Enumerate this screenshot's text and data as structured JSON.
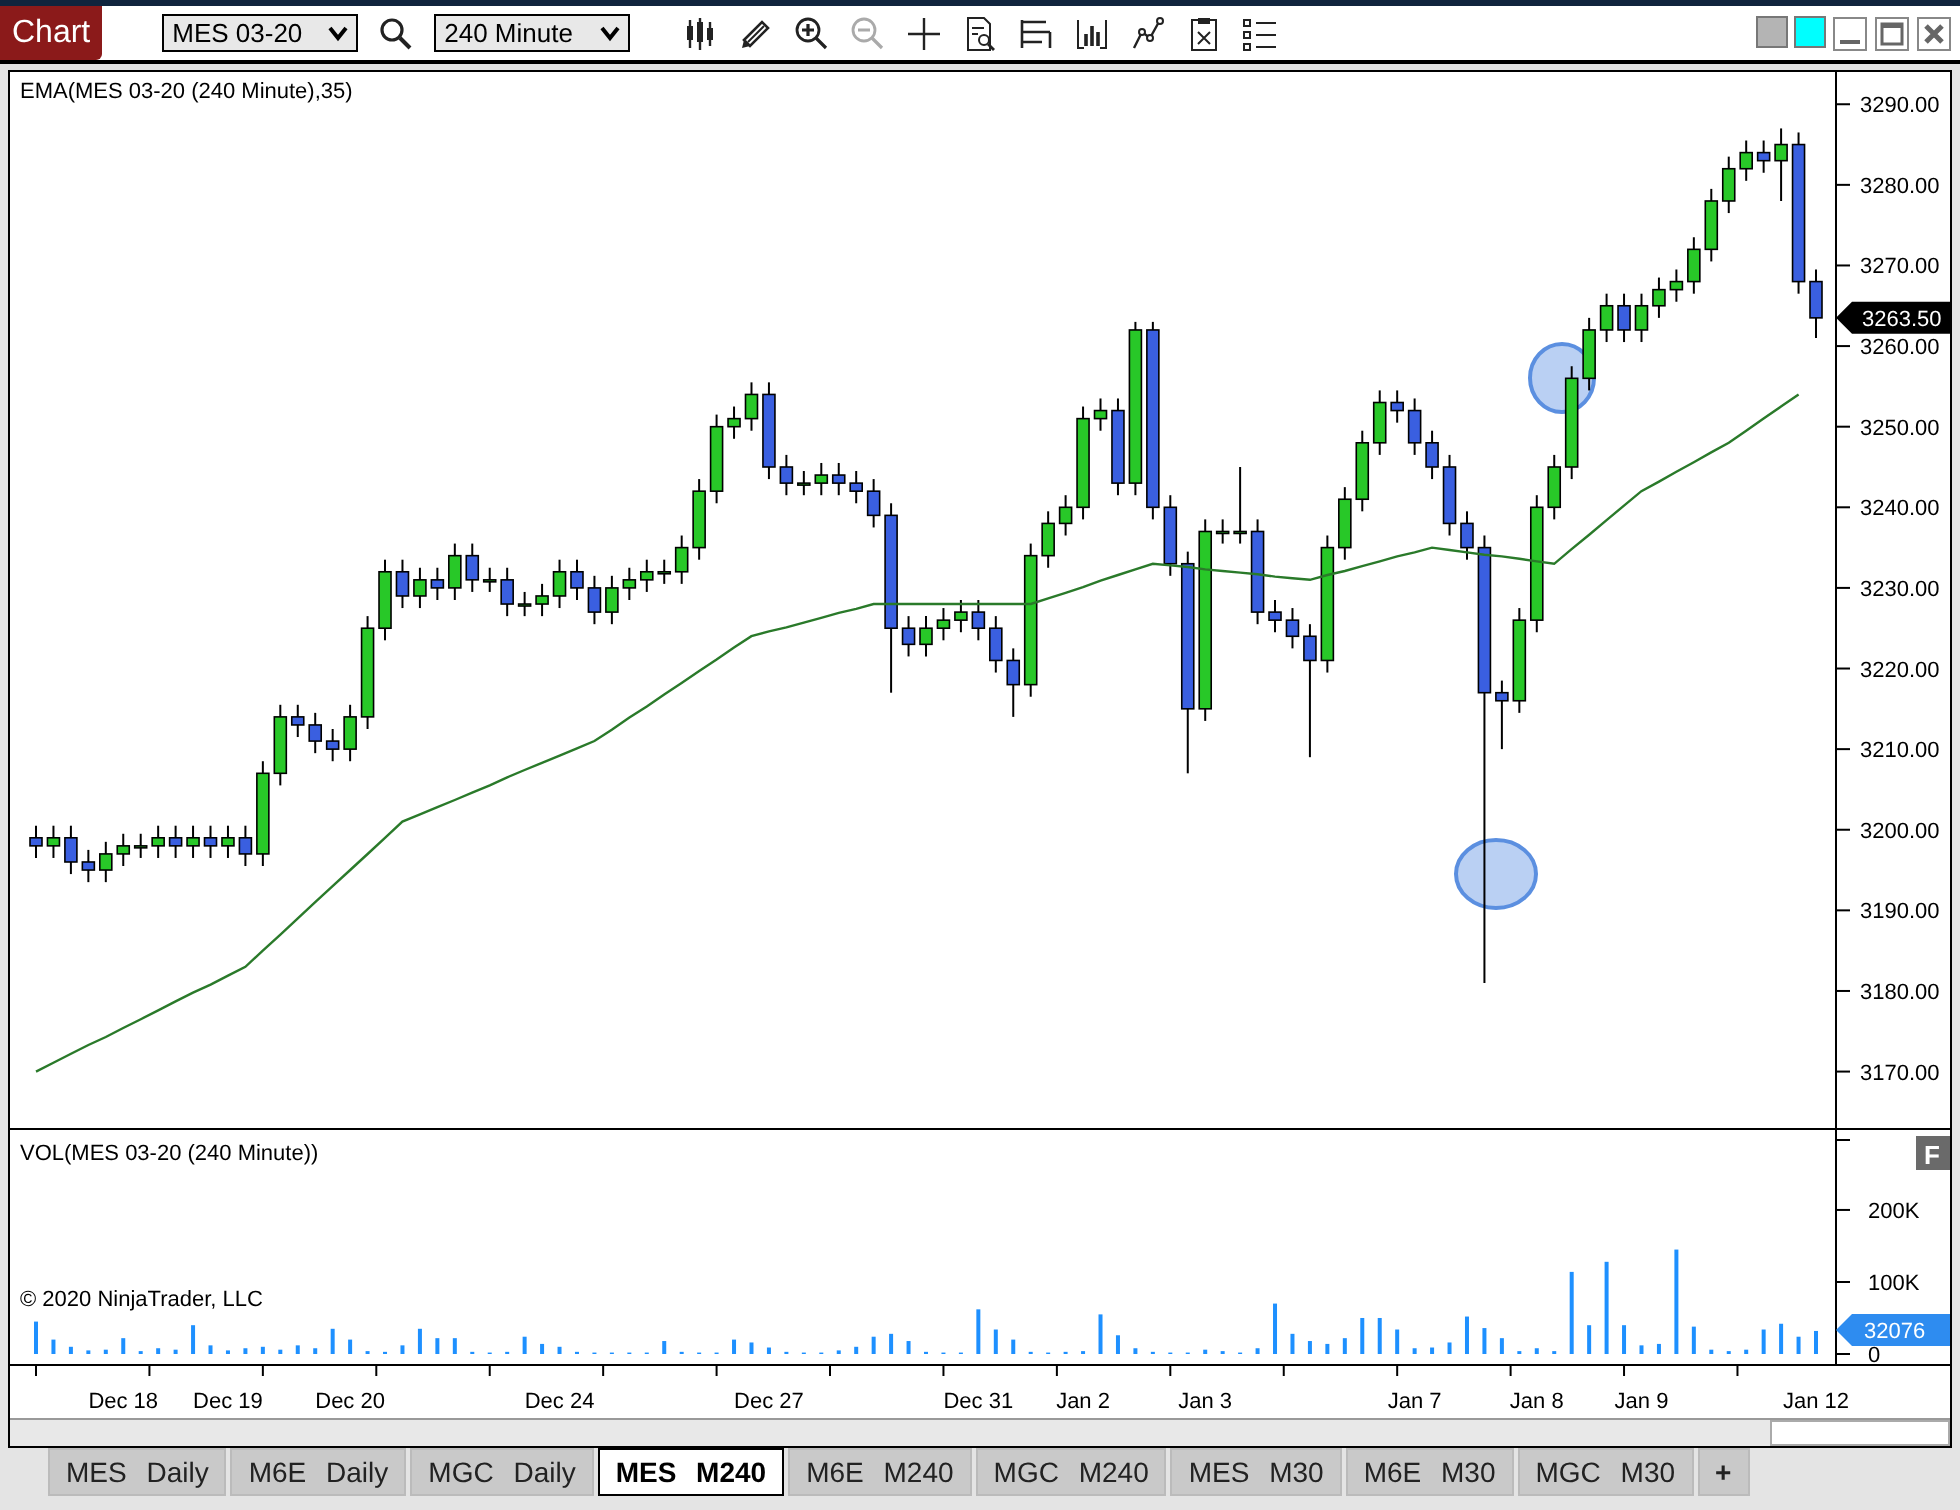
{
  "window": {
    "title": "Chart"
  },
  "toolbar": {
    "instrument": "MES 03-20",
    "interval": "240 Minute"
  },
  "price_panel": {
    "last_price": "3263.50",
    "chart_data": {
      "type": "candlestick",
      "ylim": [
        3163,
        3294
      ],
      "yticks": [
        {
          "value": 3170,
          "label": "3170.00"
        },
        {
          "value": 3180,
          "label": "3180.00"
        },
        {
          "value": 3190,
          "label": "3190.00"
        },
        {
          "value": 3200,
          "label": "3200.00"
        },
        {
          "value": 3210,
          "label": "3210.00"
        },
        {
          "value": 3220,
          "label": "3220.00"
        },
        {
          "value": 3230,
          "label": "3230.00"
        },
        {
          "value": 3240,
          "label": "3240.00"
        },
        {
          "value": 3250,
          "label": "3250.00"
        },
        {
          "value": 3260,
          "label": "3260.00"
        },
        {
          "value": 3270,
          "label": "3270.00"
        },
        {
          "value": 3280,
          "label": "3280.00"
        },
        {
          "value": 3290,
          "label": "3290.00"
        }
      ],
      "categories": [
        null,
        null,
        null,
        null,
        null,
        null,
        null,
        null,
        null,
        null,
        null,
        null,
        null,
        null,
        null,
        null,
        null,
        null,
        null,
        null,
        null,
        null,
        null,
        null,
        null,
        null,
        null,
        null,
        null,
        null,
        null,
        null,
        null,
        null,
        null,
        null,
        null,
        null,
        null,
        null,
        null,
        null,
        null,
        null,
        null,
        null,
        null,
        null,
        null,
        null,
        null,
        null,
        null,
        null,
        null,
        null,
        null,
        null,
        null,
        null,
        null,
        null,
        null,
        null,
        null,
        null,
        null,
        null,
        null,
        null,
        null,
        null,
        null,
        null,
        null,
        null,
        null,
        null,
        null,
        null,
        null,
        null,
        null,
        null,
        null,
        null,
        null,
        null,
        null,
        null,
        null,
        null,
        null,
        null,
        null,
        null,
        null,
        null,
        null,
        null,
        null,
        null,
        null
      ],
      "ohlc": [
        [
          3199,
          3200.5,
          3196.5,
          3198
        ],
        [
          3198,
          3200.5,
          3196.5,
          3199
        ],
        [
          3199,
          3200.5,
          3194.5,
          3196
        ],
        [
          3196,
          3197.5,
          3193.5,
          3195
        ],
        [
          3195,
          3198.5,
          3193.5,
          3197
        ],
        [
          3197,
          3199.5,
          3195.5,
          3198
        ],
        [
          3198,
          3199.5,
          3196.5,
          3198
        ],
        [
          3198,
          3200.5,
          3196.5,
          3199
        ],
        [
          3199,
          3200.5,
          3196.5,
          3198
        ],
        [
          3198,
          3200.5,
          3196.5,
          3199
        ],
        [
          3199,
          3200.5,
          3196.5,
          3198
        ],
        [
          3198,
          3200.5,
          3196.5,
          3199
        ],
        [
          3199,
          3200.5,
          3195.5,
          3197
        ],
        [
          3197,
          3208.5,
          3195.5,
          3207
        ],
        [
          3207,
          3215.5,
          3205.5,
          3214
        ],
        [
          3214,
          3215.5,
          3211.5,
          3213
        ],
        [
          3213,
          3214.5,
          3209.5,
          3211
        ],
        [
          3211,
          3212.5,
          3208.5,
          3210
        ],
        [
          3210,
          3215.5,
          3208.5,
          3214
        ],
        [
          3214,
          3226.5,
          3212.5,
          3225
        ],
        [
          3225,
          3233.5,
          3223.5,
          3232
        ],
        [
          3232,
          3233.5,
          3227.5,
          3229
        ],
        [
          3229,
          3232.5,
          3227.5,
          3231
        ],
        [
          3231,
          3232.5,
          3228.5,
          3230
        ],
        [
          3230,
          3235.5,
          3228.5,
          3234
        ],
        [
          3234,
          3235.5,
          3229.5,
          3231
        ],
        [
          3231,
          3232.5,
          3229.5,
          3231
        ],
        [
          3231,
          3232.5,
          3226.5,
          3228
        ],
        [
          3228,
          3229.5,
          3226.5,
          3228
        ],
        [
          3228,
          3230.5,
          3226.5,
          3229
        ],
        [
          3229,
          3233.5,
          3227.5,
          3232
        ],
        [
          3232,
          3233.5,
          3228.5,
          3230
        ],
        [
          3230,
          3231.5,
          3225.5,
          3227
        ],
        [
          3227,
          3231.5,
          3225.5,
          3230
        ],
        [
          3230,
          3232.5,
          3228.5,
          3231
        ],
        [
          3231,
          3233.5,
          3229.5,
          3232
        ],
        [
          3232,
          3233.5,
          3230.5,
          3232
        ],
        [
          3232,
          3236.5,
          3230.5,
          3235
        ],
        [
          3235,
          3243.5,
          3233.5,
          3242
        ],
        [
          3242,
          3251.5,
          3240.5,
          3250
        ],
        [
          3250,
          3252.5,
          3248.5,
          3251
        ],
        [
          3251,
          3255.5,
          3249.5,
          3254
        ],
        [
          3254,
          3255.5,
          3243.5,
          3245
        ],
        [
          3245,
          3246.5,
          3241.5,
          3243
        ],
        [
          3243,
          3244.5,
          3241.5,
          3243
        ],
        [
          3243,
          3245.5,
          3241.5,
          3244
        ],
        [
          3244,
          3245.5,
          3241.5,
          3243
        ],
        [
          3243,
          3244.5,
          3240.5,
          3242
        ],
        [
          3242,
          3243.5,
          3237.5,
          3239
        ],
        [
          3239,
          3240.5,
          3217,
          3225
        ],
        [
          3225,
          3226.5,
          3221.5,
          3223
        ],
        [
          3223,
          3226.5,
          3221.5,
          3225
        ],
        [
          3225,
          3227.5,
          3223.5,
          3226
        ],
        [
          3226,
          3228.5,
          3224.5,
          3227
        ],
        [
          3227,
          3228.5,
          3223.5,
          3225
        ],
        [
          3225,
          3226.5,
          3219.5,
          3221
        ],
        [
          3221,
          3222.5,
          3214,
          3218
        ],
        [
          3218,
          3235.5,
          3216.5,
          3234
        ],
        [
          3234,
          3239.5,
          3232.5,
          3238
        ],
        [
          3238,
          3241.5,
          3236.5,
          3240
        ],
        [
          3240,
          3252.5,
          3238.5,
          3251
        ],
        [
          3251,
          3253.5,
          3249.5,
          3252
        ],
        [
          3252,
          3253.5,
          3241.5,
          3243
        ],
        [
          3243,
          3263,
          3241.5,
          3262
        ],
        [
          3262,
          3263,
          3238.5,
          3240
        ],
        [
          3240,
          3241.5,
          3231.5,
          3233
        ],
        [
          3233,
          3234.5,
          3207,
          3215
        ],
        [
          3215,
          3238.5,
          3213.5,
          3237
        ],
        [
          3237,
          3238.5,
          3235.5,
          3237
        ],
        [
          3237,
          3245,
          3235.5,
          3237
        ],
        [
          3237,
          3238.5,
          3225.5,
          3227
        ],
        [
          3227,
          3228.5,
          3224.5,
          3226
        ],
        [
          3226,
          3227.5,
          3222.5,
          3224
        ],
        [
          3224,
          3225.5,
          3209,
          3221
        ],
        [
          3221,
          3236.5,
          3219.5,
          3235
        ],
        [
          3235,
          3242.5,
          3233.5,
          3241
        ],
        [
          3241,
          3249.5,
          3239.5,
          3248
        ],
        [
          3248,
          3254.5,
          3246.5,
          3253
        ],
        [
          3253,
          3254.5,
          3250.5,
          3252
        ],
        [
          3252,
          3253.5,
          3246.5,
          3248
        ],
        [
          3248,
          3249.5,
          3243.5,
          3245
        ],
        [
          3245,
          3246.5,
          3236.5,
          3238
        ],
        [
          3238,
          3239.5,
          3233.5,
          3235
        ],
        [
          3235,
          3236.5,
          3181,
          3217
        ],
        [
          3217,
          3218.5,
          3210,
          3216
        ],
        [
          3216,
          3227.5,
          3214.5,
          3226
        ],
        [
          3226,
          3241.5,
          3224.5,
          3240
        ],
        [
          3240,
          3246.5,
          3238.5,
          3245
        ],
        [
          3245,
          3257.5,
          3243.5,
          3256
        ],
        [
          3256,
          3263.5,
          3254.5,
          3262
        ],
        [
          3262,
          3266.5,
          3260.5,
          3265
        ],
        [
          3265,
          3266.5,
          3260.5,
          3262
        ],
        [
          3262,
          3266.5,
          3260.5,
          3265
        ],
        [
          3265,
          3268.5,
          3263.5,
          3267
        ],
        [
          3267,
          3269.5,
          3265.5,
          3268
        ],
        [
          3268,
          3273.5,
          3266.5,
          3272
        ],
        [
          3272,
          3279.5,
          3270.5,
          3278
        ],
        [
          3278,
          3283.5,
          3276.5,
          3282
        ],
        [
          3282,
          3285.5,
          3280.5,
          3284
        ],
        [
          3284,
          3285.5,
          3281.5,
          3283
        ],
        [
          3283,
          3287,
          3278,
          3285
        ],
        [
          3285,
          3286.5,
          3266.5,
          3268
        ],
        [
          3268,
          3269.5,
          3261,
          3263.5
        ]
      ],
      "series": [
        {
          "name": "EMA(MES 03-20 (240 Minute),35)",
          "type": "line",
          "color": "#2a7a2a",
          "values": [
            3170,
            3171.1,
            3172.2,
            3173.3,
            3174.3,
            3175.4,
            3176.5,
            3177.6,
            3178.7,
            3179.8,
            3180.8,
            3181.9,
            3183,
            3185,
            3187,
            3189,
            3191,
            3193,
            3195,
            3197,
            3199,
            3201,
            3201.9,
            3202.8,
            3203.7,
            3204.6,
            3205.5,
            3206.5,
            3207.4,
            3208.3,
            3209.2,
            3210.1,
            3211,
            3212.4,
            3213.9,
            3215.3,
            3216.8,
            3218.2,
            3219.7,
            3221.1,
            3222.6,
            3224,
            3224.6,
            3225.1,
            3225.7,
            3226.3,
            3226.9,
            3227.4,
            3228,
            3228,
            3228,
            3228,
            3228,
            3228,
            3228,
            3228,
            3228,
            3228,
            3228.7,
            3229.4,
            3230.1,
            3230.9,
            3231.6,
            3232.3,
            3233,
            3232.8,
            3232.6,
            3232.3,
            3232.1,
            3231.9,
            3231.7,
            3231.4,
            3231.2,
            3231,
            3231.6,
            3232.1,
            3232.7,
            3233.3,
            3233.9,
            3234.4,
            3235,
            3234.7,
            3234.4,
            3234.1,
            3233.9,
            3233.6,
            3233.3,
            3233,
            3234.8,
            3236.6,
            3238.4,
            3240.2,
            3242,
            3243.2,
            3244.4,
            3245.6,
            3246.8,
            3248,
            3249.5,
            3251,
            3252.5,
            3254,
            null
          ]
        }
      ]
    }
  },
  "volume_panel": {
    "copyright": "© 2020 NinjaTrader, LLC",
    "last_volume": "32076",
    "f_button": "F",
    "chart_data": {
      "type": "bar",
      "ylim": [
        0,
        311
      ],
      "yticks": [
        {
          "value": 0,
          "label": "0"
        },
        {
          "value": 100,
          "label": "100K"
        },
        {
          "value": 200,
          "label": "200K"
        }
      ],
      "categories": [
        null,
        null,
        null,
        null,
        null,
        "Dec 18",
        null,
        null,
        null,
        null,
        null,
        "Dec 19",
        null,
        null,
        null,
        null,
        null,
        null,
        "Dec 20",
        null,
        null,
        null,
        null,
        null,
        null,
        null,
        null,
        null,
        null,
        null,
        "Dec 24",
        null,
        null,
        null,
        null,
        null,
        null,
        null,
        null,
        null,
        null,
        null,
        "Dec 27",
        null,
        null,
        null,
        null,
        null,
        null,
        null,
        null,
        null,
        null,
        null,
        "Dec 31",
        null,
        null,
        null,
        null,
        null,
        "Jan 2",
        null,
        null,
        null,
        null,
        null,
        null,
        "Jan 3",
        null,
        null,
        null,
        null,
        null,
        null,
        null,
        null,
        null,
        null,
        null,
        "Jan 7",
        null,
        null,
        null,
        null,
        null,
        null,
        "Jan 8",
        null,
        null,
        null,
        null,
        null,
        "Jan 9",
        null,
        null,
        null,
        null,
        null,
        null,
        null,
        null,
        null,
        "Jan 12"
      ],
      "series": [
        {
          "name": "VOL(MES 03-20 (240 Minute))",
          "color": "#1e90ff",
          "values": [
            45,
            20,
            10,
            5,
            6,
            22,
            4,
            8,
            6,
            40,
            12,
            5,
            8,
            10,
            6,
            12,
            8,
            35,
            20,
            4,
            3,
            12,
            35,
            22,
            22,
            3,
            2,
            3,
            24,
            14,
            10,
            3,
            2,
            2,
            2,
            2,
            18,
            3,
            2,
            2,
            20,
            16,
            9,
            3,
            2,
            2,
            5,
            10,
            24,
            28,
            18,
            3,
            2,
            2,
            62,
            34,
            20,
            3,
            2,
            3,
            4,
            55,
            26,
            8,
            3,
            2,
            2,
            6,
            4,
            2,
            8,
            70,
            28,
            18,
            14,
            22,
            50,
            50,
            34,
            8,
            9,
            16,
            52,
            36,
            22,
            4,
            8,
            4,
            114,
            40,
            128,
            40,
            12,
            14,
            145,
            38,
            6,
            4,
            6,
            34,
            42,
            24,
            32
          ]
        }
      ]
    }
  },
  "tabs": [
    {
      "symbol": "MES",
      "period": "Daily",
      "selected": false
    },
    {
      "symbol": "M6E",
      "period": "Daily",
      "selected": false
    },
    {
      "symbol": "MGC",
      "period": "Daily",
      "selected": false
    },
    {
      "symbol": "MES",
      "period": "M240",
      "selected": true
    },
    {
      "symbol": "M6E",
      "period": "M240",
      "selected": false
    },
    {
      "symbol": "MGC",
      "period": "M240",
      "selected": false
    },
    {
      "symbol": "MES",
      "period": "M30",
      "selected": false
    },
    {
      "symbol": "M6E",
      "period": "M30",
      "selected": false
    },
    {
      "symbol": "MGC",
      "period": "M30",
      "selected": false
    }
  ],
  "add_tab": "+"
}
